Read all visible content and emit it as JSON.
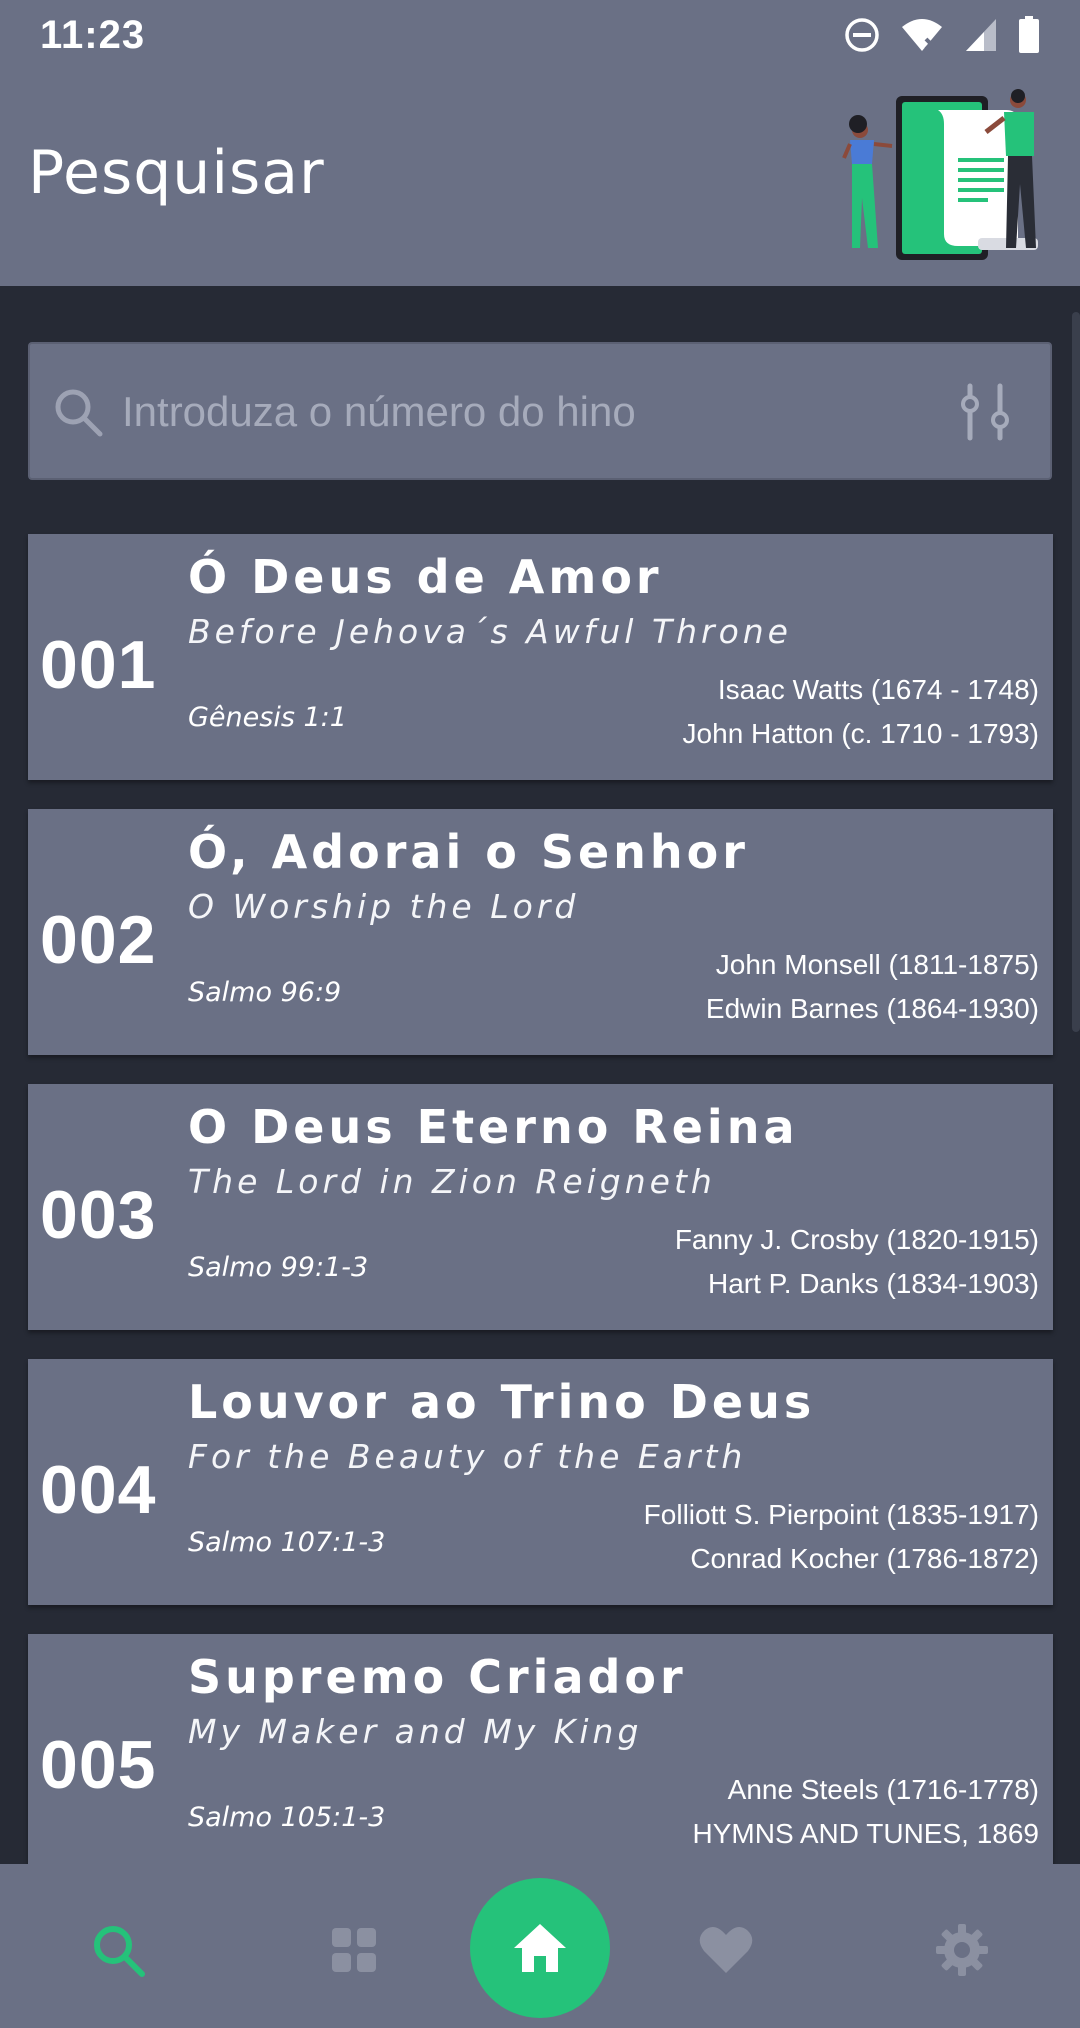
{
  "status_bar": {
    "time": "11:23"
  },
  "header": {
    "title": "Pesquisar"
  },
  "search": {
    "placeholder": "Introduza o número do hino"
  },
  "hymns": [
    {
      "number": "001",
      "title": "Ó Deus de Amor",
      "subtitle": "Before Jehova´s Awful Throne",
      "reference": "Gênesis 1:1",
      "author_1": "Isaac Watts (1674 - 1748)",
      "author_2": "John Hatton (c. 1710 - 1793)"
    },
    {
      "number": "002",
      "title": "Ó, Adorai o Senhor",
      "subtitle": "O Worship the Lord",
      "reference": "Salmo 96:9",
      "author_1": "John Monsell (1811-1875)",
      "author_2": "Edwin Barnes (1864-1930)"
    },
    {
      "number": "003",
      "title": "O Deus Eterno Reina",
      "subtitle": "The Lord in Zion Reigneth",
      "reference": "Salmo 99:1-3",
      "author_1": "Fanny J. Crosby (1820-1915)",
      "author_2": "Hart P. Danks (1834-1903)"
    },
    {
      "number": "004",
      "title": "Louvor ao Trino Deus",
      "subtitle": "For the Beauty of the Earth",
      "reference": "Salmo 107:1-3",
      "author_1": "Folliott S. Pierpoint (1835-1917)",
      "author_2": "Conrad Kocher (1786-1872)"
    },
    {
      "number": "005",
      "title": "Supremo Criador",
      "subtitle": "My Maker and My King",
      "reference": "Salmo 105:1-3",
      "author_1": "Anne Steels (1716-1778)",
      "author_2": "HYMNS AND TUNES, 1869"
    }
  ],
  "bottom_nav": {
    "items": [
      {
        "icon": "search-icon",
        "active": true
      },
      {
        "icon": "grid-icon",
        "active": false
      },
      {
        "icon": "home-icon",
        "active": false
      },
      {
        "icon": "heart-icon",
        "active": false
      },
      {
        "icon": "gear-icon",
        "active": false
      }
    ]
  },
  "colors": {
    "accent": "#25c27a",
    "surface": "#6a7085",
    "background": "#262a35"
  }
}
